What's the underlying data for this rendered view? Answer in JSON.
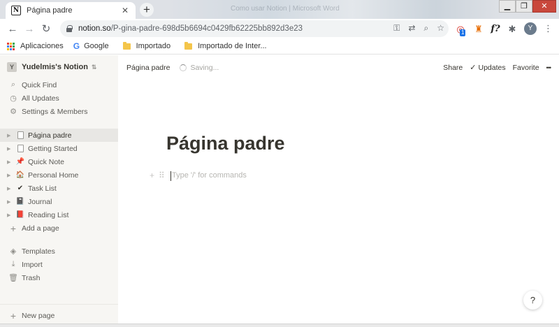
{
  "browser": {
    "tab_title": "Página padre",
    "tab_favicon": "N",
    "tab_close": "✕",
    "new_tab": "+",
    "background_tab_text": "Como usar Notion | Microsoft Word",
    "window": {
      "minimize": "▁",
      "maximize": "❐",
      "close": "✕"
    },
    "url_host": "notion.so",
    "url_path": "/P-gina-padre-698d5b6694c0429fb62225bb892d3e23",
    "profile_initial": "Y",
    "extension_badge": "1"
  },
  "bookmarks": {
    "apps": "Aplicaciones",
    "google": "Google",
    "importado": "Importado",
    "importado_de_inter": "Importado de Inter..."
  },
  "sidebar": {
    "workspace_badge": "Y",
    "workspace_name": "Yudelmis's Notion",
    "nav": [
      "Quick Find",
      "All Updates",
      "Settings & Members"
    ],
    "pages": [
      {
        "label": "Página padre",
        "icon": "📄"
      },
      {
        "label": "Getting Started",
        "icon": "📄"
      },
      {
        "label": "Quick Note",
        "icon": "📌"
      },
      {
        "label": "Personal Home",
        "icon": "🏠"
      },
      {
        "label": "Task List",
        "icon": "✔"
      },
      {
        "label": "Journal",
        "icon": "📓"
      },
      {
        "label": "Reading List",
        "icon": "📕"
      }
    ],
    "add_page": "Add a page",
    "tools": [
      "Templates",
      "Import",
      "Trash"
    ],
    "new_page": "New page"
  },
  "topbar": {
    "breadcrumb": "Página padre",
    "saving": "Saving...",
    "share": "Share",
    "updates": "Updates",
    "favorite": "Favorite",
    "more": "•••"
  },
  "page": {
    "title": "Página padre",
    "placeholder": "Type '/' for commands"
  },
  "help": "?",
  "colors": {
    "sidebar_bg": "#f7f6f3",
    "text": "#37352f",
    "placeholder": "#b7b6b2",
    "google_apps_dots": [
      "#ea4335",
      "#fbbc05",
      "#34a853",
      "#4285f4",
      "#ea4335",
      "#34a853",
      "#fbbc05",
      "#4285f4",
      "#ea4335"
    ]
  }
}
